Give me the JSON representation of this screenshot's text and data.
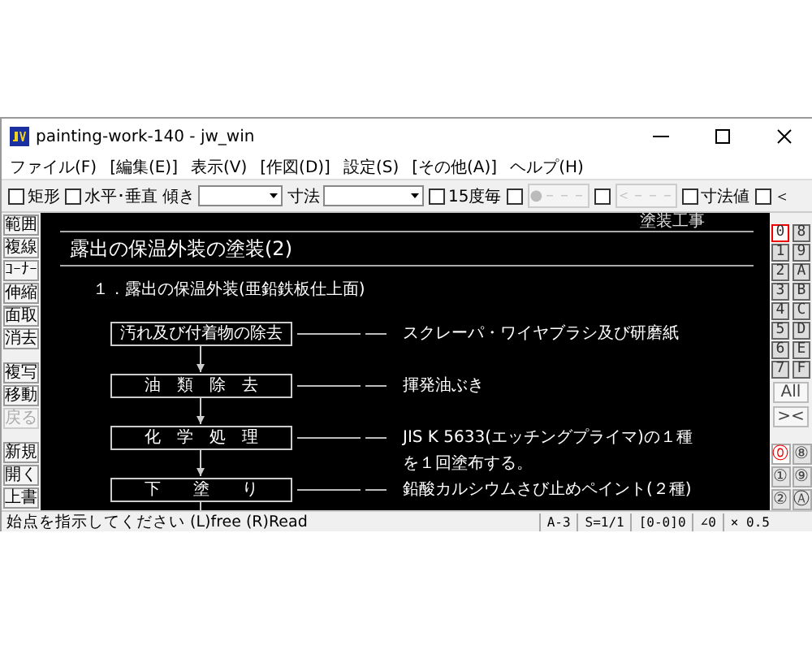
{
  "window": {
    "title": "painting-work-140 - jw_win"
  },
  "menu": [
    "ファイル(F)",
    "[編集(E)]",
    "表示(V)",
    "[作図(D)]",
    "設定(S)",
    "[その他(A)]",
    "ヘルプ(H)"
  ],
  "toolbar": [
    {
      "kind": "checkbox",
      "label": "矩形",
      "checked": false
    },
    {
      "kind": "checkbox",
      "label": "水平･垂直",
      "checked": false
    },
    {
      "kind": "combo",
      "label": "傾き"
    },
    {
      "kind": "combo",
      "label": "寸法"
    },
    {
      "kind": "checkbox",
      "label": "15度毎",
      "checked": false
    },
    {
      "kind": "checkbox",
      "checked": false
    },
    {
      "kind": "button",
      "label": "●－－－",
      "disabled": true
    },
    {
      "kind": "checkbox",
      "checked": false
    },
    {
      "kind": "button",
      "label": "＜－－－",
      "disabled": true
    },
    {
      "kind": "checkbox",
      "label": "寸法値",
      "checked": false
    },
    {
      "kind": "checkbox",
      "label": "＜",
      "checked": false
    }
  ],
  "left_tools": [
    [
      {
        "label": "範囲",
        "disabled": false
      },
      {
        "label": "複線",
        "disabled": false
      },
      {
        "label": "ｺｰﾅｰ",
        "disabled": false
      },
      {
        "label": "伸縮",
        "disabled": false
      },
      {
        "label": "面取",
        "disabled": false
      },
      {
        "label": "消去",
        "disabled": false
      }
    ],
    [
      {
        "label": "複写",
        "disabled": false
      },
      {
        "label": "移動",
        "disabled": false
      },
      {
        "label": "戻る",
        "disabled": true
      }
    ],
    [
      {
        "label": "新規",
        "disabled": false
      },
      {
        "label": "開く",
        "disabled": false
      },
      {
        "label": "上書",
        "disabled": false
      }
    ]
  ],
  "drawing": {
    "header": "塗装工事",
    "title": "露出の保温外装の塗装(2)",
    "section": "１．露出の保温外装(亜鉛鉄板仕上面)",
    "steps": [
      {
        "label": "汚れ及び付着物の除去",
        "notes": [
          "スクレーパ・ワイヤブラシ及び研磨紙"
        ]
      },
      {
        "label": "油　類　除　去",
        "notes": [
          "揮発油ぶき"
        ]
      },
      {
        "label": "化　学　処　理",
        "notes": [
          "JIS K 5633(エッチングプライマ)の１種",
          "を１回塗布する。"
        ]
      },
      {
        "label": "下　　塗　　り",
        "notes": [
          "鉛酸カルシウムさび止めペイント(２種)"
        ]
      }
    ]
  },
  "layers": [
    {
      "label": "0",
      "selected": true
    },
    {
      "label": "1",
      "selected": false
    },
    {
      "label": "2",
      "selected": false
    },
    {
      "label": "3",
      "selected": false
    },
    {
      "label": "4",
      "selected": false
    },
    {
      "label": "5",
      "selected": false
    },
    {
      "label": "6",
      "selected": false
    },
    {
      "label": "7",
      "selected": false
    },
    {
      "label": "8",
      "selected": false
    },
    {
      "label": "9",
      "selected": false
    },
    {
      "label": "A",
      "selected": false
    },
    {
      "label": "B",
      "selected": false
    },
    {
      "label": "C",
      "selected": false
    },
    {
      "label": "D",
      "selected": false
    },
    {
      "label": "E",
      "selected": false
    },
    {
      "label": "F",
      "selected": false
    }
  ],
  "layer_buttons": [
    "All",
    "><"
  ],
  "layer_groups": [
    {
      "label": "⓪",
      "selected": true
    },
    {
      "label": "⑧",
      "selected": false
    },
    {
      "label": "①",
      "selected": false
    },
    {
      "label": "⑨",
      "selected": false
    },
    {
      "label": "②",
      "selected": false
    },
    {
      "label": "Ⓐ",
      "selected": false
    }
  ],
  "status_bar": {
    "message": "始点を指示してください (L)free (R)Read",
    "fields": [
      "A-3",
      "S=1/1",
      "[0-0]0",
      "∠0",
      "× 0.5"
    ]
  }
}
